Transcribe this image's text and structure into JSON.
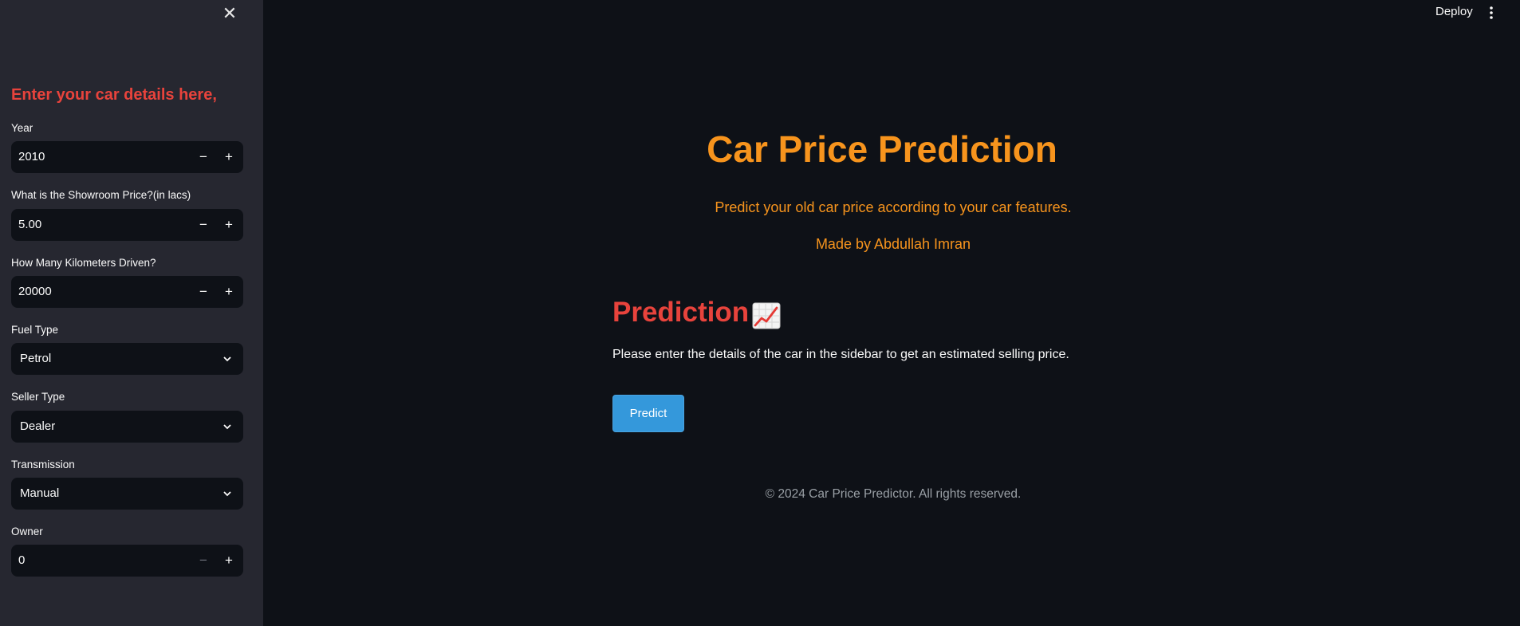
{
  "sidebar": {
    "heading": "Enter your car details here,",
    "close_icon": "close-icon",
    "year": {
      "label": "Year",
      "value": "2010"
    },
    "showroom_price": {
      "label": "What is the Showroom Price?(in lacs)",
      "value": "5.00"
    },
    "kms_driven": {
      "label": "How Many Kilometers Driven?",
      "value": "20000"
    },
    "fuel_type": {
      "label": "Fuel Type",
      "value": "Petrol"
    },
    "seller_type": {
      "label": "Seller Type",
      "value": "Dealer"
    },
    "transmission": {
      "label": "Transmission",
      "value": "Manual"
    },
    "owner": {
      "label": "Owner",
      "value": "0"
    },
    "minus_symbol": "−",
    "plus_symbol": "+"
  },
  "header": {
    "deploy_label": "Deploy",
    "menu_icon": "more-vertical-icon"
  },
  "main": {
    "title": "Car Price Prediction",
    "subtitle": "Predict your old car price according to your car features.",
    "author": "Made by Abdullah Imran",
    "prediction_heading": "Prediction",
    "prediction_icon": "chart-increasing-icon",
    "instructions": "Please enter the details of the car in the sidebar to get an estimated selling price.",
    "predict_button": "Predict",
    "footer": "© 2024 Car Price Predictor. All rights reserved."
  },
  "colors": {
    "orange": "#f7941d",
    "red": "#e8433c",
    "button_blue": "#3498db",
    "sidebar_bg": "#262730",
    "main_bg": "#0e1117"
  }
}
